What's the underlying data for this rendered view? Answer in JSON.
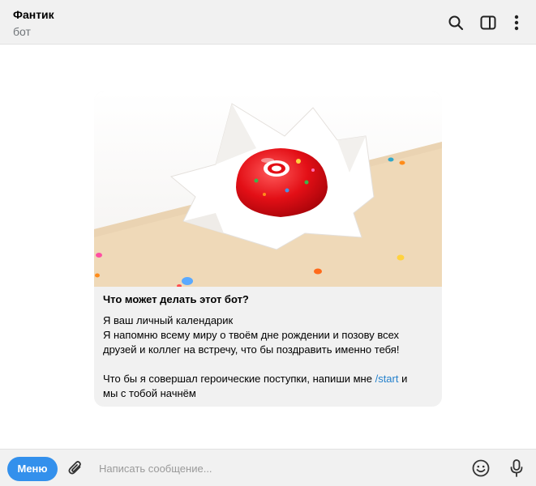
{
  "header": {
    "title": "Фантик",
    "subtitle": "бот",
    "icons": [
      "search-icon",
      "sidebar-toggle-icon",
      "more-vertical-icon"
    ]
  },
  "bot_info": {
    "image": "red-candy-cake-in-paper-wrapper",
    "heading": "Что может делать этот бот?",
    "line1": "Я ваш личный календарик",
    "line2": "Я напомню всему миру о твоём дне рождении и позову всех",
    "line3": "друзей и коллег на встречу, что бы поздравить именно тебя!",
    "line4_before": "Что бы я совершал героические поступки, напиши мне ",
    "command": "/start",
    "line4_after": " и",
    "line5": "мы с тобой начнём"
  },
  "composer": {
    "menu_label": "Меню",
    "placeholder": "Написать сообщение...",
    "icons": [
      "paperclip-icon",
      "emoji-icon",
      "microphone-icon"
    ]
  },
  "colors": {
    "accent": "#3390ec",
    "link": "#2481cc",
    "panel": "#f1f1f1"
  }
}
